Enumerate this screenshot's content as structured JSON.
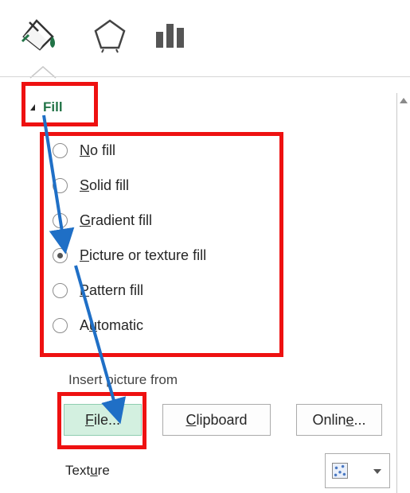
{
  "toolbar": {
    "icons": [
      "fill-and-line-icon",
      "effects-icon",
      "size-and-properties-icon"
    ]
  },
  "section": {
    "title": "Fill"
  },
  "fill_options": [
    {
      "pre": "",
      "key": "N",
      "post": "o fill",
      "checked": false
    },
    {
      "pre": "",
      "key": "S",
      "post": "olid fill",
      "checked": false
    },
    {
      "pre": "",
      "key": "G",
      "post": "radient fill",
      "checked": false
    },
    {
      "pre": "",
      "key": "P",
      "post": "icture or texture fill",
      "checked": true
    },
    {
      "pre": "",
      "key": "P",
      "post": "attern fill",
      "checked": false
    },
    {
      "pre": "A",
      "key": "u",
      "post": "tomatic",
      "checked": false
    }
  ],
  "insert_from": {
    "label": "Insert picture from",
    "file": {
      "pre": "",
      "key": "F",
      "post": "ile..."
    },
    "clipboard": {
      "pre": "",
      "key": "C",
      "post": "lipboard"
    },
    "online": {
      "pre": "Onlin",
      "key": "e",
      "post": "..."
    }
  },
  "texture": {
    "pre": "Text",
    "key": "u",
    "post": "re"
  },
  "colors": {
    "accent_green": "#217346",
    "highlight_red": "#ee1111",
    "arrow_blue": "#1f6fc6",
    "file_button_bg": "#d3f0e0"
  }
}
